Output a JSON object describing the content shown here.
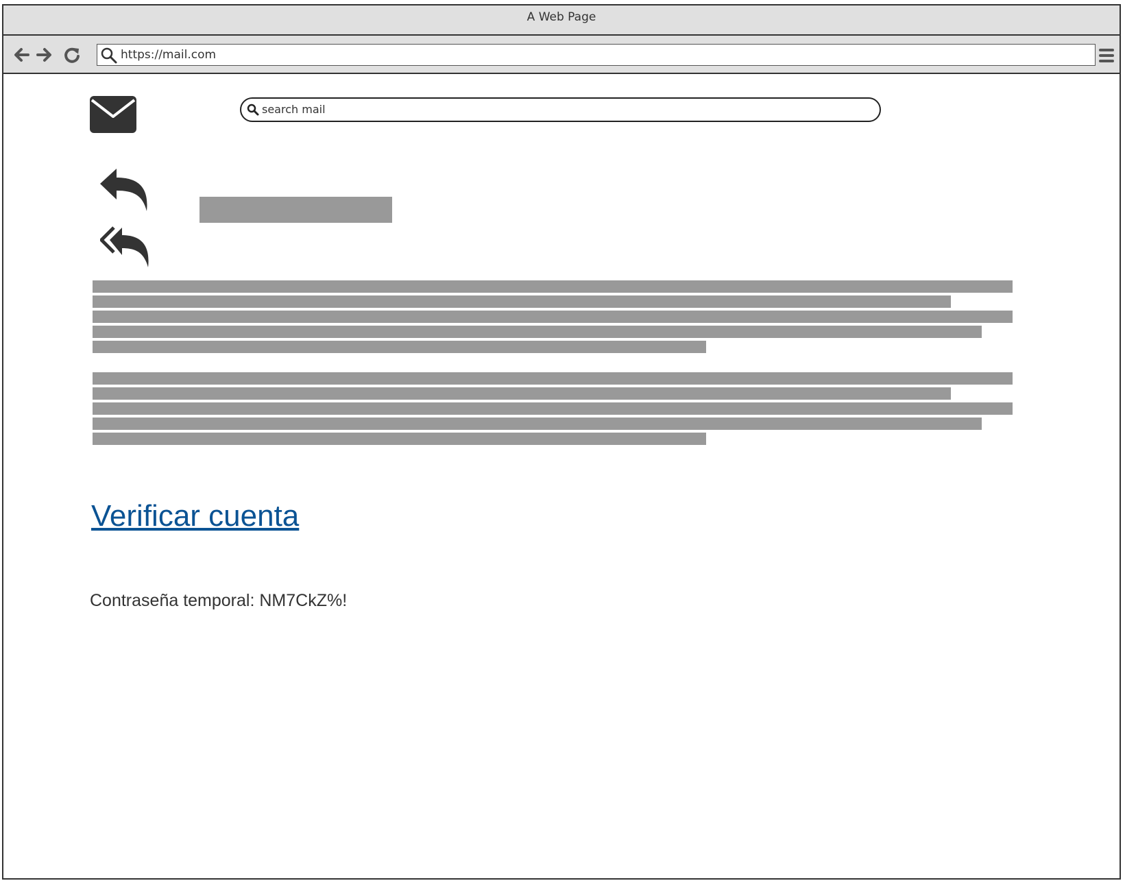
{
  "window": {
    "title": "A Web Page"
  },
  "toolbar": {
    "url": "https://mail.com",
    "icons": [
      "back-icon",
      "forward-icon",
      "reload-icon",
      "search-icon",
      "menu-icon"
    ]
  },
  "mail": {
    "logo_icon": "envelope-icon",
    "search_placeholder": "search mail",
    "actions": [
      "reply-icon",
      "reply-all-icon"
    ],
    "verify_link_label": "Verificar cuenta",
    "temp_password_text": "Contraseña temporal: NM7CkZ%!"
  },
  "colors": {
    "chrome_bg": "#e0e0e0",
    "border": "#333333",
    "placeholder_block": "#999999",
    "link": "#0b5394",
    "text": "#333333"
  }
}
